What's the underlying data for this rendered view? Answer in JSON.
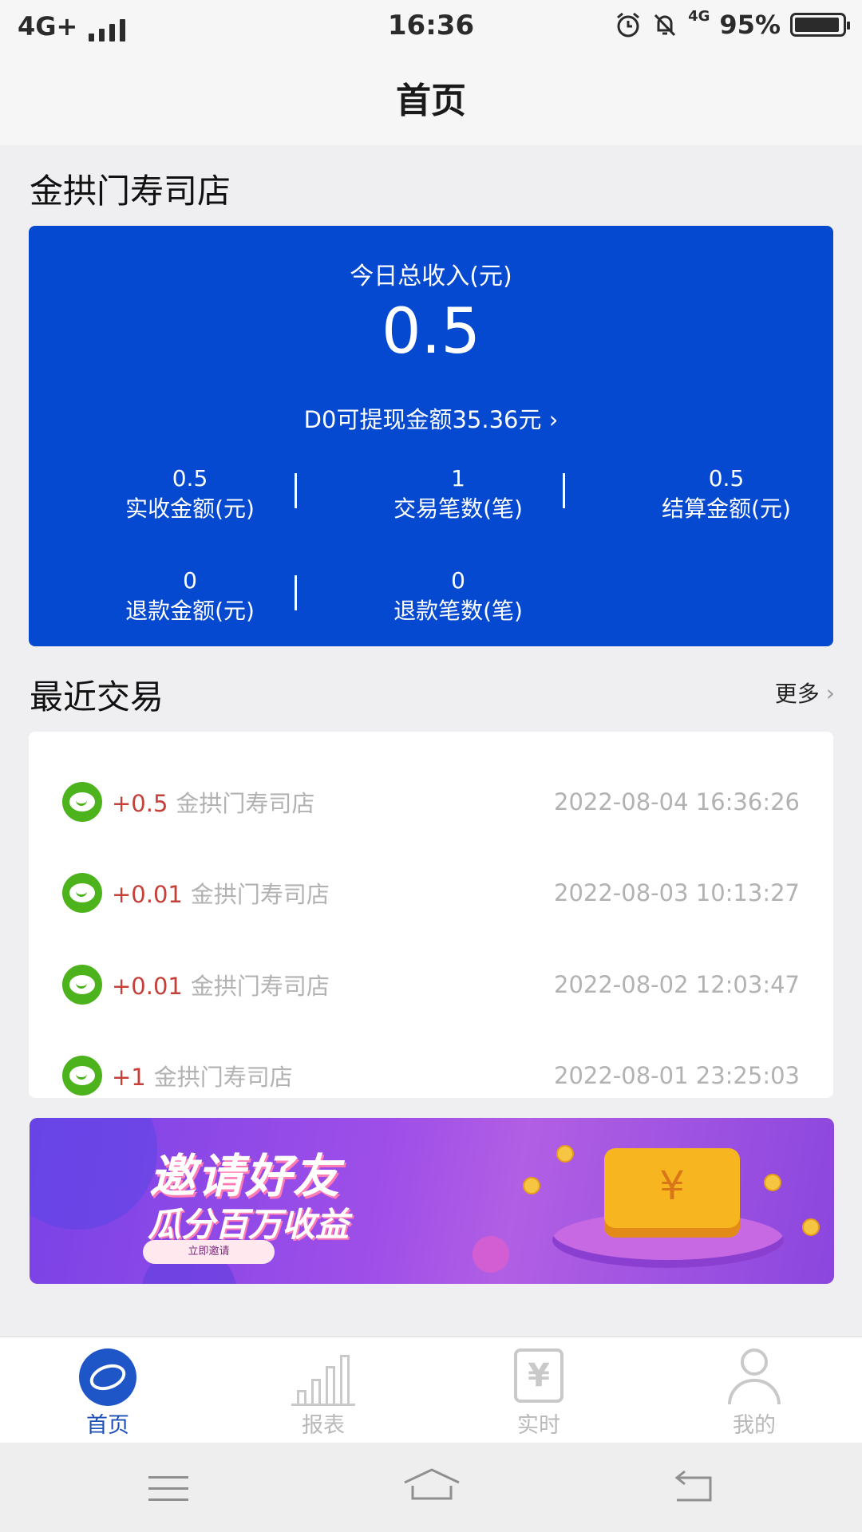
{
  "status_bar": {
    "network": "4G+",
    "time": "16:36",
    "battery_percent": "95%",
    "mini_network": "4G"
  },
  "header": {
    "title": "首页"
  },
  "store": {
    "name": "金拱门寿司店"
  },
  "income_card": {
    "label": "今日总收入(元)",
    "value": "0.5",
    "withdraw_text": "D0可提现金额35.36元",
    "stats": [
      {
        "value": "0.5",
        "label": "实收金额(元)"
      },
      {
        "value": "1",
        "label": "交易笔数(笔)"
      },
      {
        "value": "0.5",
        "label": "结算金额(元)"
      },
      {
        "value": "0",
        "label": "退款金额(元)"
      },
      {
        "value": "0",
        "label": "退款笔数(笔)"
      }
    ]
  },
  "recent": {
    "title": "最近交易",
    "more_label": "更多",
    "transactions": [
      {
        "amount": "+0.5",
        "store": "金拱门寿司店",
        "time": "2022-08-04 16:36:26"
      },
      {
        "amount": "+0.01",
        "store": "金拱门寿司店",
        "time": "2022-08-03 10:13:27"
      },
      {
        "amount": "+0.01",
        "store": "金拱门寿司店",
        "time": "2022-08-02 12:03:47"
      },
      {
        "amount": "+1",
        "store": "金拱门寿司店",
        "time": "2022-08-01 23:25:03"
      }
    ]
  },
  "banner": {
    "title": "邀请好友",
    "subtitle": "瓜分百万收益",
    "button_label": "立即邀请",
    "currency_symbol": "¥"
  },
  "tab_bar": {
    "tabs": [
      {
        "label": "首页",
        "icon": "home-logo-icon",
        "active": true
      },
      {
        "label": "报表",
        "icon": "bar-chart-icon",
        "active": false
      },
      {
        "label": "实时",
        "icon": "yen-receipt-icon",
        "active": false
      },
      {
        "label": "我的",
        "icon": "user-icon",
        "active": false
      }
    ],
    "realtime_symbol": "¥"
  },
  "colors": {
    "card_blue": "#0449d0",
    "amount_red": "#c6403a",
    "wechat_green": "#4db31d",
    "tab_active": "#1d4fb8"
  }
}
